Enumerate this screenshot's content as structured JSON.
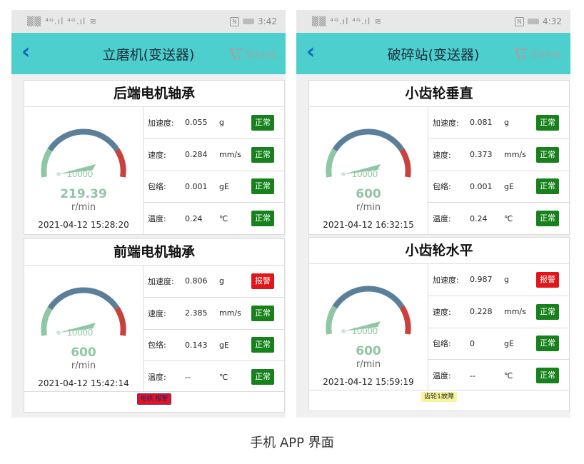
{
  "phones": [
    {
      "statusbar": {
        "left": "▒▒ ⁴ᴳ.ıl ⁴ᴳ.ıl ≋",
        "nfc": "N",
        "time": "3:42"
      },
      "title": "立磨机(变送器)",
      "logo_text": "宏远科技",
      "cards": [
        {
          "title": "后端电机轴承",
          "gauge_label": "10000",
          "rpm": "219.39",
          "rpm_unit": "r/min",
          "time": "2021-04-12 15:28:20",
          "rows": [
            {
              "label": "加速度:",
              "value": "0.055",
              "unit": "g",
              "status": "正常"
            },
            {
              "label": "速度:",
              "value": "0.284",
              "unit": "mm/s",
              "status": "正常"
            },
            {
              "label": "包络:",
              "value": "0.001",
              "unit": "gE",
              "status": "正常"
            },
            {
              "label": "温度:",
              "value": "0.24",
              "unit": "℃",
              "status": "正常"
            }
          ]
        },
        {
          "title": "前端电机轴承",
          "gauge_label": "10000",
          "rpm": "600",
          "rpm_unit": "r/min",
          "time": "2021-04-12 15:42:14",
          "rows": [
            {
              "label": "加速度:",
              "value": "0.806",
              "unit": "g",
              "status": "报警"
            },
            {
              "label": "速度:",
              "value": "2.385",
              "unit": "mm/s",
              "status": "正常"
            },
            {
              "label": "包络:",
              "value": "0.143",
              "unit": "gE",
              "status": "正常"
            },
            {
              "label": "温度:",
              "value": "--",
              "unit": "℃",
              "status": "正常"
            }
          ]
        }
      ],
      "footer_tag": "电机 报警"
    },
    {
      "statusbar": {
        "left": "▒▒ ⁴ᴳ.ıl ⁴ᴳ.ıl ≋",
        "nfc": "N",
        "time": "4:32"
      },
      "title": "破碎站(变送器)",
      "logo_text": "宏远科技",
      "cards": [
        {
          "title": "小齿轮垂直",
          "gauge_label": "10000",
          "rpm": "600",
          "rpm_unit": "r/min",
          "time": "2021-04-12 16:32:15",
          "rows": [
            {
              "label": "加速度:",
              "value": "0.081",
              "unit": "g",
              "status": "正常"
            },
            {
              "label": "速度:",
              "value": "0.373",
              "unit": "mm/s",
              "status": "正常"
            },
            {
              "label": "包络:",
              "value": "0.001",
              "unit": "gE",
              "status": "正常"
            },
            {
              "label": "温度:",
              "value": "0.24",
              "unit": "℃",
              "status": "正常"
            }
          ]
        },
        {
          "title": "小齿轮水平",
          "gauge_label": "10000",
          "rpm": "600",
          "rpm_unit": "r/min",
          "time": "2021-04-12 15:59:19",
          "rows": [
            {
              "label": "加速度:",
              "value": "0.987",
              "unit": "g",
              "status": "报警"
            },
            {
              "label": "速度:",
              "value": "0.228",
              "unit": "mm/s",
              "status": "正常"
            },
            {
              "label": "包络:",
              "value": "0",
              "unit": "gE",
              "status": "正常"
            },
            {
              "label": "温度:",
              "value": "--",
              "unit": "℃",
              "status": "正常"
            }
          ]
        }
      ],
      "footer_tag": "齿轮1故障"
    }
  ],
  "caption": "手机 APP 界面",
  "colors": {
    "appbar": "#4dd0cd",
    "back_icon": "#1565c0",
    "ok_badge": "#17811c",
    "alarm_badge": "#e0161b",
    "rpm_text": "#8fc6a3",
    "gauge_green": "#8fc6a3",
    "gauge_steel": "#5b7f9a",
    "gauge_red": "#c9403c"
  },
  "icons": {
    "back": "chevron-left-icon",
    "logo": "company-logo-icon",
    "gauge": "speedometer-gauge-icon"
  }
}
